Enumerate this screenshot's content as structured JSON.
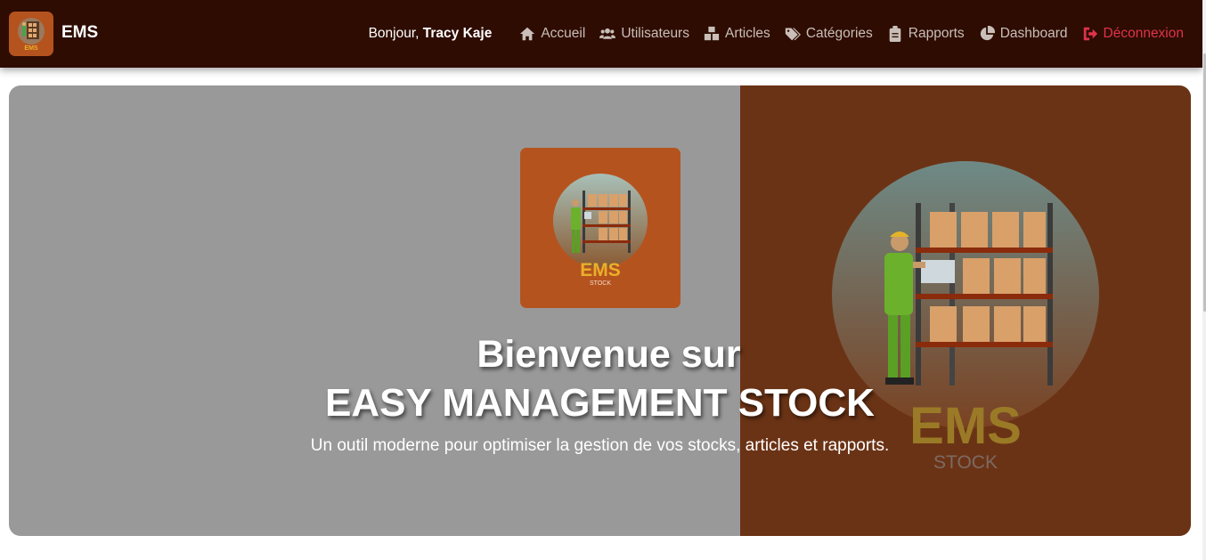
{
  "navbar": {
    "brand": "EMS",
    "greeting_prefix": "Bonjour,",
    "user_name": "Tracy Kaje",
    "links": [
      {
        "label": "Accueil",
        "icon": "home-icon"
      },
      {
        "label": "Utilisateurs",
        "icon": "users-icon"
      },
      {
        "label": "Articles",
        "icon": "boxes-icon"
      },
      {
        "label": "Catégories",
        "icon": "tags-icon"
      },
      {
        "label": "Rapports",
        "icon": "clipboard-icon"
      },
      {
        "label": "Dashboard",
        "icon": "pie-chart-icon"
      },
      {
        "label": "Déconnexion",
        "icon": "logout-icon"
      }
    ]
  },
  "hero": {
    "title_line1": "Bienvenue sur",
    "title_line2": "EASY MANAGEMENT STOCK",
    "subtitle": "Un outil moderne pour optimiser la gestion de vos stocks, articles et rapports.",
    "logo_text": "EMS",
    "logo_subtext": "STOCK"
  },
  "colors": {
    "navbar_bg": "#2e0c02",
    "accent": "#b5531f",
    "hero_right_bg": "#6b3315",
    "logout": "#e0334a",
    "logo_text": "#e8b02a"
  }
}
